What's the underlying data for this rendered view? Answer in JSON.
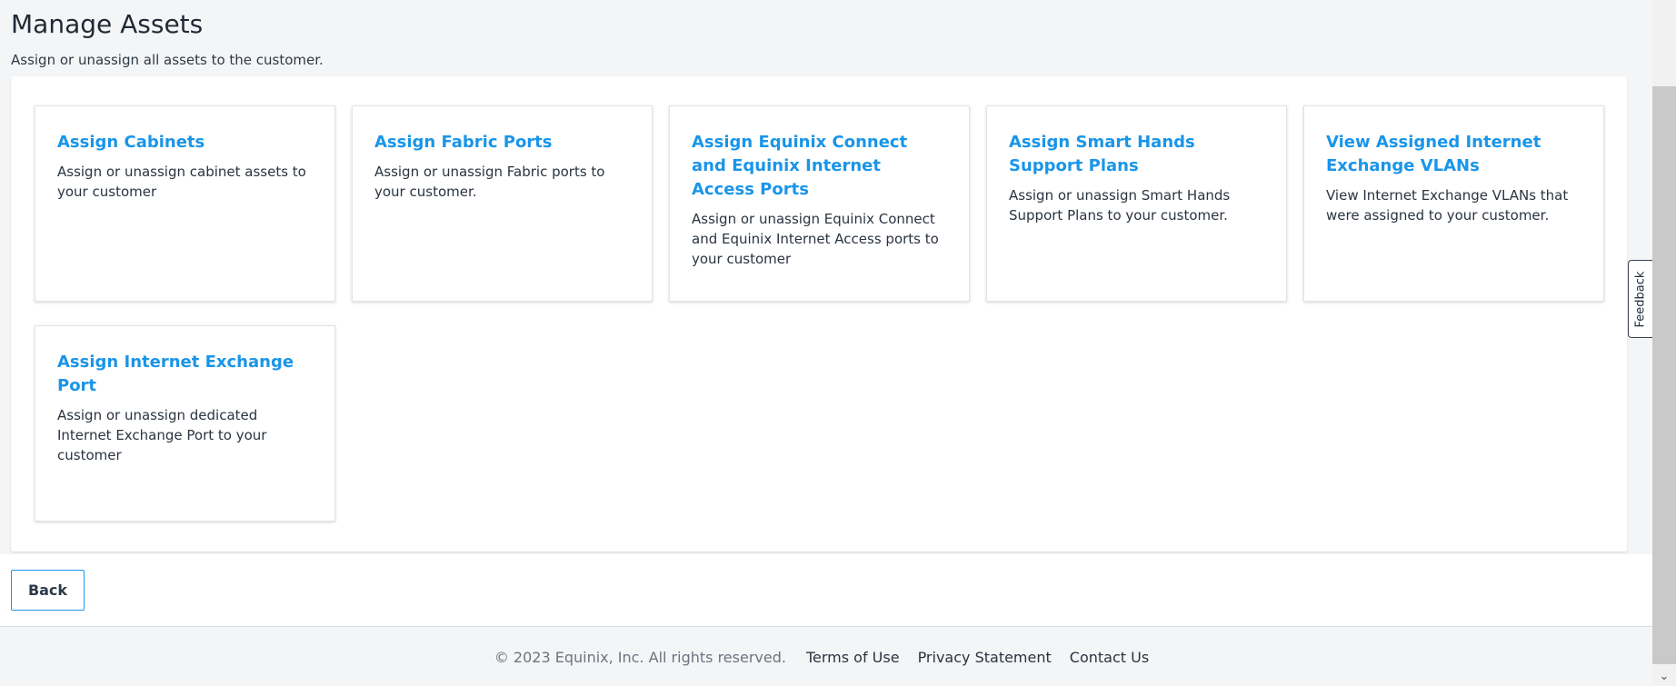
{
  "header": {
    "title": "Manage Assets",
    "subtitle": "Assign or unassign all assets to the customer."
  },
  "cards": [
    {
      "title": "Assign Cabinets",
      "description": "Assign or unassign cabinet assets to your customer"
    },
    {
      "title": "Assign Fabric Ports",
      "description": "Assign or unassign Fabric ports to your customer."
    },
    {
      "title": "Assign Equinix Connect and Equinix Internet Access Ports",
      "description": "Assign or unassign Equinix Connect and Equinix Internet Access ports to your customer"
    },
    {
      "title": "Assign Smart Hands Support Plans",
      "description": "Assign or unassign Smart Hands Support Plans to your customer."
    },
    {
      "title": "View Assigned Internet Exchange VLANs",
      "description": "View Internet Exchange VLANs that were assigned to your customer."
    },
    {
      "title": "Assign Internet Exchange Port",
      "description": "Assign or unassign dedicated Internet Exchange Port to your customer"
    }
  ],
  "actions": {
    "back_label": "Back"
  },
  "footer": {
    "copyright": "© 2023 Equinix, Inc. All rights reserved.",
    "links": [
      "Terms of Use",
      "Privacy Statement",
      "Contact Us"
    ]
  },
  "feedback": {
    "label": "Feedback"
  },
  "colors": {
    "accent": "#1a95e8",
    "background": "#f4f5f6",
    "text": "#1f2a36"
  }
}
